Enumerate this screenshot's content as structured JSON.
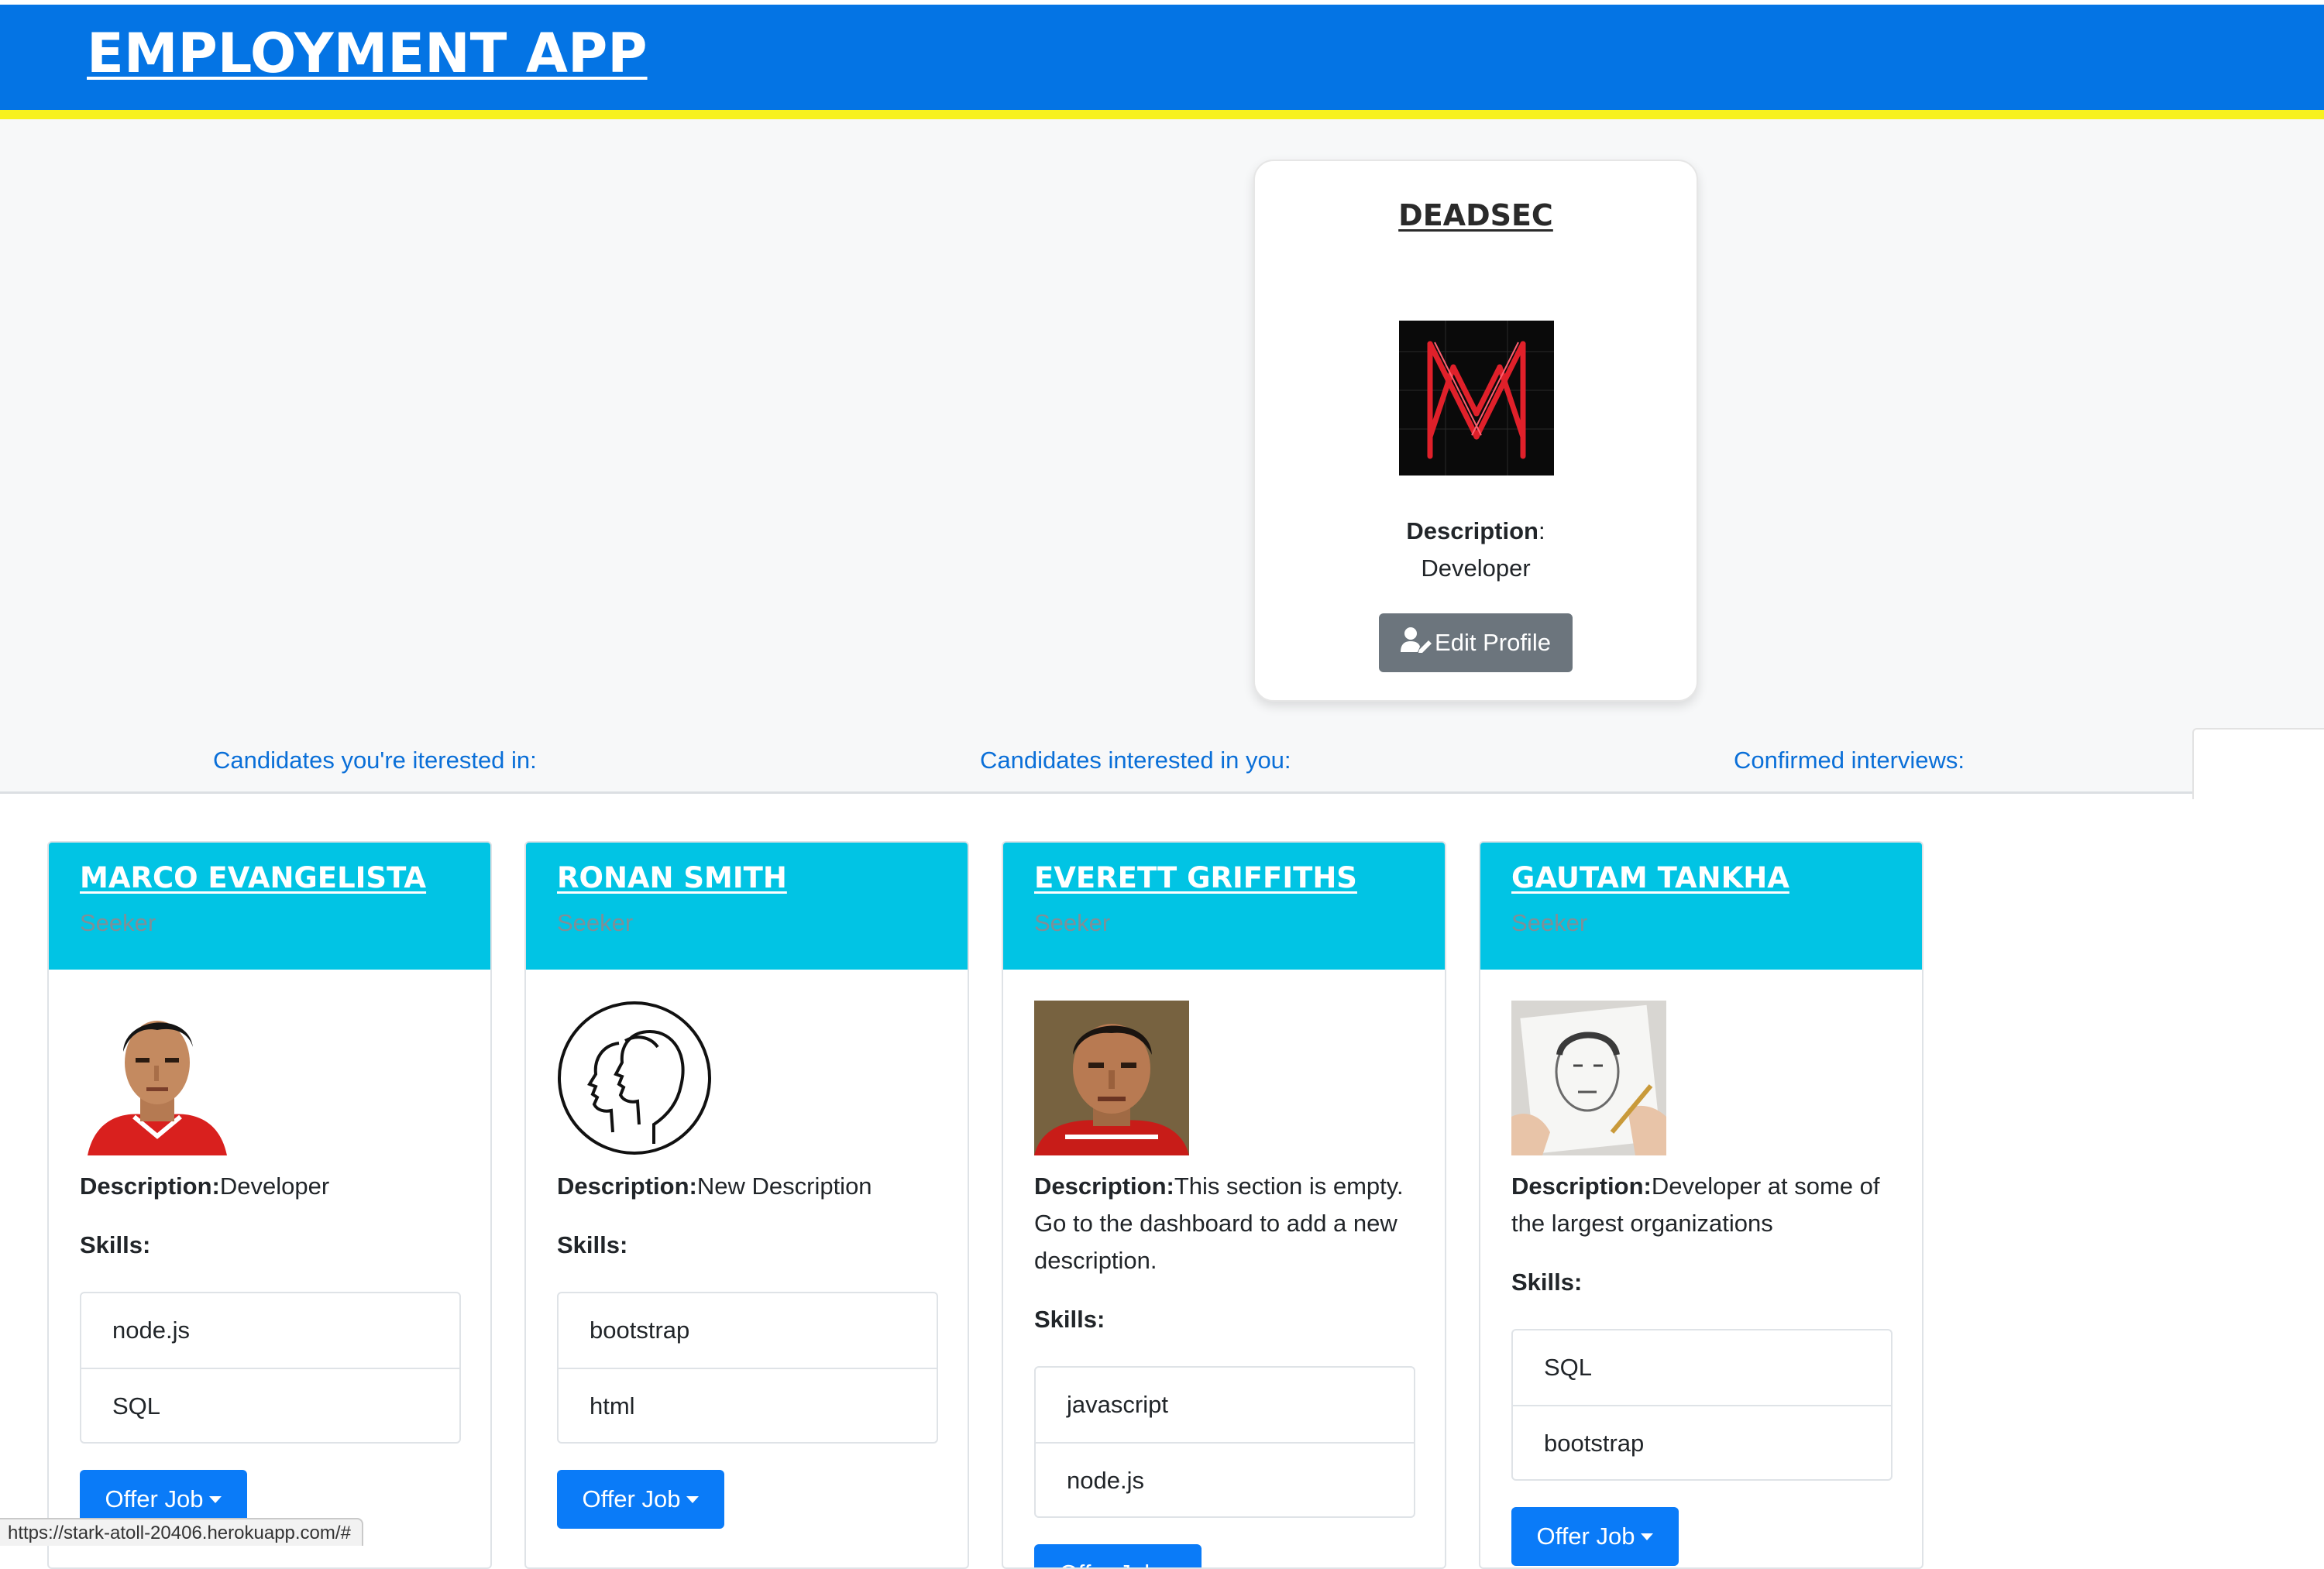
{
  "header": {
    "title": "EMPLOYMENT APP",
    "colors": {
      "bar": "#0474e4",
      "stripe": "#f7f11f"
    }
  },
  "profile": {
    "name": "DEADSEC",
    "avatar_icon": "deadsec-logo-icon",
    "description_label": "Description",
    "description_value": "Developer",
    "edit_button": "Edit Profile",
    "edit_icon": "user-edit-icon"
  },
  "tabs": [
    {
      "label": "Candidates you're iterested in:"
    },
    {
      "label": "Candidates interested in you:"
    },
    {
      "label": "Confirmed interviews:"
    }
  ],
  "candidates": [
    {
      "name": "MARCO EVANGELISTA",
      "role": "Seeker",
      "avatar_icon": "pixel-racer-portrait-icon",
      "description_label": "Description:",
      "description": "Developer",
      "skills_label": "Skills:",
      "skills": [
        "node.js",
        "SQL"
      ],
      "offer_button": "Offer Job"
    },
    {
      "name": "RONAN SMITH",
      "role": "Seeker",
      "avatar_icon": "two-faces-outline-icon",
      "description_label": "Description:",
      "description": "New Description",
      "skills_label": "Skills:",
      "skills": [
        "bootstrap",
        "html"
      ],
      "offer_button": "Offer Job"
    },
    {
      "name": "EVERETT GRIFFITHS",
      "role": "Seeker",
      "avatar_icon": "pixel-driver-portrait-icon",
      "description_label": "Description:",
      "description": "This section is empty. Go to the dashboard to add a new description.",
      "skills_label": "Skills:",
      "skills": [
        "javascript",
        "node.js"
      ],
      "offer_button": "Offer Job"
    },
    {
      "name": "GAUTAM TANKHA",
      "role": "Seeker",
      "avatar_icon": "pencil-sketch-portrait-icon",
      "description_label": "Description:",
      "description": "Developer at some of the largest organizations",
      "skills_label": "Skills:",
      "skills": [
        "SQL",
        "bootstrap"
      ],
      "offer_button": "Offer Job"
    }
  ],
  "status_bar": {
    "url": "https://stark-atoll-20406.herokuapp.com/#"
  }
}
